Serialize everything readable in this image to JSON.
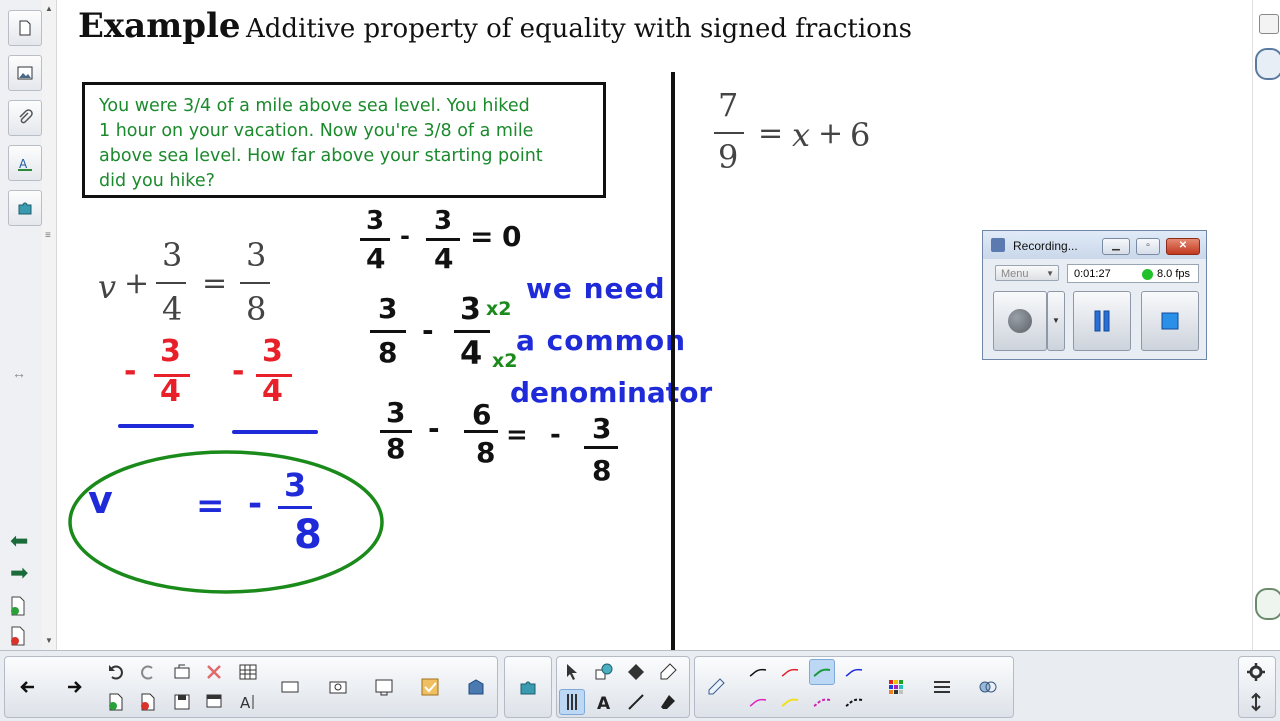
{
  "page": {
    "title_bold": "Example",
    "title_rest": "Additive property of equality with signed fractions",
    "problem_lines": [
      "You were 3/4 of a mile above sea level.  You hiked",
      "1 hour on your vacation.  Now you're 3/8 of a mile",
      "above sea level.  How far above your starting point",
      "did you hike?"
    ],
    "equation_left": {
      "variable": "v",
      "plus": "+",
      "num1": "3",
      "den1": "4",
      "equals": "=",
      "num2": "3",
      "den2": "8"
    },
    "equation_right": {
      "num": "7",
      "den": "9",
      "equals": "=",
      "x": "x",
      "plus": "+",
      "six": "6"
    },
    "handwriting": {
      "subtract_left": {
        "sign": "-",
        "num": "3",
        "den": "4"
      },
      "subtract_right": {
        "sign": "-",
        "num": "3",
        "den": "4"
      },
      "answer_var": "v",
      "answer_equals": "=",
      "answer_sign": "-",
      "answer_num": "3",
      "answer_den": "8",
      "line1": {
        "num_a": "3",
        "den_a": "4",
        "minus": "-",
        "num_b": "3",
        "den_b": "4",
        "eq": "=",
        "result": "0"
      },
      "line2": {
        "num_a": "3",
        "den_a": "8",
        "minus": "-",
        "num_b": "3",
        "den_b": "4",
        "times_top": "x2",
        "times_bottom": "x2"
      },
      "line3": {
        "num_a": "3",
        "den_a": "8",
        "minus": "-",
        "num_b": "6",
        "den_b": "8",
        "eq": "=",
        "sign": "-",
        "num_c": "3",
        "den_c": "8"
      },
      "note": [
        "we need",
        "a common",
        "denominator"
      ]
    }
  },
  "recorder": {
    "title": "Recording...",
    "menu_label": "Menu",
    "elapsed": "0:01:27",
    "fps": "8.0 fps",
    "status_color": "#22c02a"
  },
  "colors": {
    "problem_text": "#1b8a2c",
    "red_ink": "#e8202a",
    "blue_ink": "#1f2bd8",
    "green_ink": "#1a8a1a"
  },
  "toolbar": {
    "icons": [
      "back-arrow-icon",
      "forward-arrow-icon",
      "undo-icon",
      "redo-icon",
      "open-icon",
      "delete-icon",
      "table-icon",
      "new-page-icon",
      "delete-page-icon",
      "save-icon",
      "screen-shade-icon",
      "text-insert-icon",
      "video-icon",
      "capture-icon",
      "document-camera-icon",
      "response-icon",
      "gallery-icon",
      "add-ons-icon",
      "select-icon",
      "shapes-icon",
      "fill-icon",
      "highlighter-icon",
      "pens-icon",
      "text-icon",
      "line-icon",
      "eraser-icon",
      "pen-icon",
      "color-grid-icon",
      "properties-icon",
      "link-icon",
      "settings-icon",
      "move-toolbar-icon"
    ]
  }
}
